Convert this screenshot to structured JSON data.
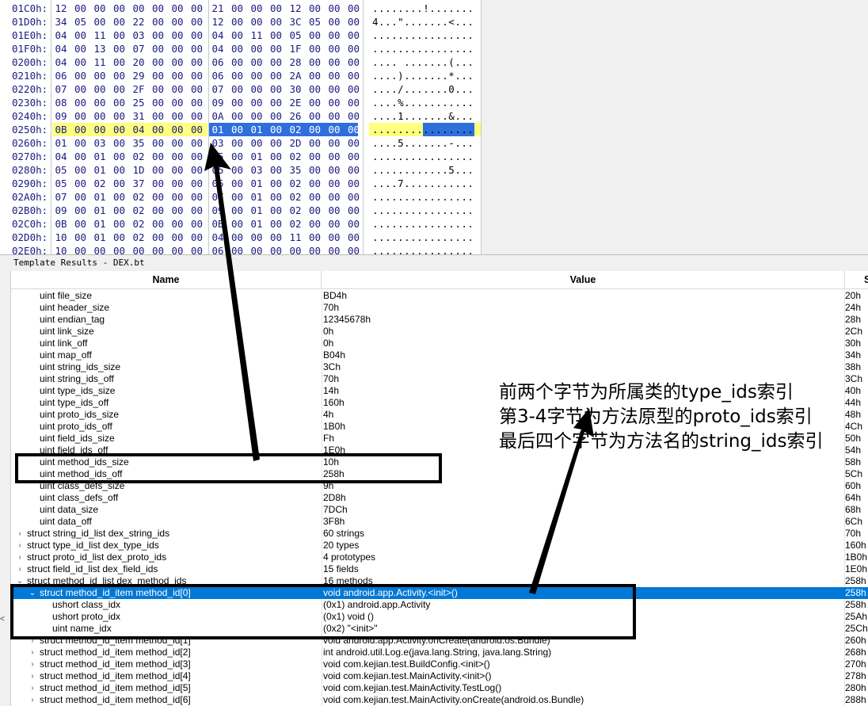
{
  "hex_view": {
    "rows": [
      {
        "addr": "01C0h:",
        "bytes": [
          "12",
          "00",
          "00",
          "00",
          "00",
          "00",
          "00",
          "00",
          "21",
          "00",
          "00",
          "00",
          "12",
          "00",
          "00",
          "00"
        ],
        "ascii": "........!......."
      },
      {
        "addr": "01D0h:",
        "bytes": [
          "34",
          "05",
          "00",
          "00",
          "22",
          "00",
          "00",
          "00",
          "12",
          "00",
          "00",
          "00",
          "3C",
          "05",
          "00",
          "00"
        ],
        "ascii": "4...\".......<..."
      },
      {
        "addr": "01E0h:",
        "bytes": [
          "04",
          "00",
          "11",
          "00",
          "03",
          "00",
          "00",
          "00",
          "04",
          "00",
          "11",
          "00",
          "05",
          "00",
          "00",
          "00"
        ],
        "ascii": "................"
      },
      {
        "addr": "01F0h:",
        "bytes": [
          "04",
          "00",
          "13",
          "00",
          "07",
          "00",
          "00",
          "00",
          "04",
          "00",
          "00",
          "00",
          "1F",
          "00",
          "00",
          "00"
        ],
        "ascii": "................"
      },
      {
        "addr": "0200h:",
        "bytes": [
          "04",
          "00",
          "11",
          "00",
          "20",
          "00",
          "00",
          "00",
          "06",
          "00",
          "00",
          "00",
          "28",
          "00",
          "00",
          "00"
        ],
        "ascii": ".... .......(..."
      },
      {
        "addr": "0210h:",
        "bytes": [
          "06",
          "00",
          "00",
          "00",
          "29",
          "00",
          "00",
          "00",
          "06",
          "00",
          "00",
          "00",
          "2A",
          "00",
          "00",
          "00"
        ],
        "ascii": "....).......*..."
      },
      {
        "addr": "0220h:",
        "bytes": [
          "07",
          "00",
          "00",
          "00",
          "2F",
          "00",
          "00",
          "00",
          "07",
          "00",
          "00",
          "00",
          "30",
          "00",
          "00",
          "00"
        ],
        "ascii": "..../.......0..."
      },
      {
        "addr": "0230h:",
        "bytes": [
          "08",
          "00",
          "00",
          "00",
          "25",
          "00",
          "00",
          "00",
          "09",
          "00",
          "00",
          "00",
          "2E",
          "00",
          "00",
          "00"
        ],
        "ascii": "....%..........."
      },
      {
        "addr": "0240h:",
        "bytes": [
          "09",
          "00",
          "00",
          "00",
          "31",
          "00",
          "00",
          "00",
          "0A",
          "00",
          "00",
          "00",
          "26",
          "00",
          "00",
          "00"
        ],
        "ascii": "....1.......&..."
      },
      {
        "addr": "0250h:",
        "bytes": [
          "0B",
          "00",
          "00",
          "00",
          "04",
          "00",
          "00",
          "00",
          "01",
          "00",
          "01",
          "00",
          "02",
          "00",
          "00",
          "00"
        ],
        "ascii": "................"
      },
      {
        "addr": "0260h:",
        "bytes": [
          "01",
          "00",
          "03",
          "00",
          "35",
          "00",
          "00",
          "00",
          "03",
          "00",
          "00",
          "00",
          "2D",
          "00",
          "00",
          "00"
        ],
        "ascii": "....5.......-..."
      },
      {
        "addr": "0270h:",
        "bytes": [
          "04",
          "00",
          "01",
          "00",
          "02",
          "00",
          "00",
          "00",
          "05",
          "00",
          "01",
          "00",
          "02",
          "00",
          "00",
          "00"
        ],
        "ascii": "................"
      },
      {
        "addr": "0280h:",
        "bytes": [
          "05",
          "00",
          "01",
          "00",
          "1D",
          "00",
          "00",
          "00",
          "05",
          "00",
          "03",
          "00",
          "35",
          "00",
          "00",
          "00"
        ],
        "ascii": "............5..."
      },
      {
        "addr": "0290h:",
        "bytes": [
          "05",
          "00",
          "02",
          "00",
          "37",
          "00",
          "00",
          "00",
          "05",
          "00",
          "01",
          "00",
          "02",
          "00",
          "00",
          "00"
        ],
        "ascii": "....7..........."
      },
      {
        "addr": "02A0h:",
        "bytes": [
          "07",
          "00",
          "01",
          "00",
          "02",
          "00",
          "00",
          "00",
          "07",
          "00",
          "01",
          "00",
          "02",
          "00",
          "00",
          "00"
        ],
        "ascii": "................"
      },
      {
        "addr": "02B0h:",
        "bytes": [
          "09",
          "00",
          "01",
          "00",
          "02",
          "00",
          "00",
          "00",
          "09",
          "00",
          "01",
          "00",
          "02",
          "00",
          "00",
          "00"
        ],
        "ascii": "................"
      },
      {
        "addr": "02C0h:",
        "bytes": [
          "0B",
          "00",
          "01",
          "00",
          "02",
          "00",
          "00",
          "00",
          "0B",
          "00",
          "01",
          "00",
          "02",
          "00",
          "00",
          "00"
        ],
        "ascii": "................"
      },
      {
        "addr": "02D0h:",
        "bytes": [
          "10",
          "00",
          "01",
          "00",
          "02",
          "00",
          "00",
          "00",
          "04",
          "00",
          "00",
          "00",
          "11",
          "00",
          "00",
          "00"
        ],
        "ascii": "................"
      },
      {
        "addr": "02E0h:",
        "bytes": [
          "10",
          "00",
          "00",
          "00",
          "00",
          "00",
          "00",
          "00",
          "06",
          "00",
          "00",
          "00",
          "00",
          "00",
          "00",
          "00"
        ],
        "ascii": "................"
      }
    ]
  },
  "template_results": {
    "title": "Template Results - DEX.bt",
    "columns": {
      "name": "Name",
      "value": "Value",
      "start": "S"
    },
    "rows": [
      {
        "name": "uint file_size",
        "value": "BD4h",
        "start": "20h",
        "indent": 2,
        "expander": ""
      },
      {
        "name": "uint header_size",
        "value": "70h",
        "start": "24h",
        "indent": 2,
        "expander": ""
      },
      {
        "name": "uint endian_tag",
        "value": "12345678h",
        "start": "28h",
        "indent": 2,
        "expander": ""
      },
      {
        "name": "uint link_size",
        "value": "0h",
        "start": "2Ch",
        "indent": 2,
        "expander": ""
      },
      {
        "name": "uint link_off",
        "value": "0h",
        "start": "30h",
        "indent": 2,
        "expander": ""
      },
      {
        "name": "uint map_off",
        "value": "B04h",
        "start": "34h",
        "indent": 2,
        "expander": ""
      },
      {
        "name": "uint string_ids_size",
        "value": "3Ch",
        "start": "38h",
        "indent": 2,
        "expander": ""
      },
      {
        "name": "uint string_ids_off",
        "value": "70h",
        "start": "3Ch",
        "indent": 2,
        "expander": ""
      },
      {
        "name": "uint type_ids_size",
        "value": "14h",
        "start": "40h",
        "indent": 2,
        "expander": ""
      },
      {
        "name": "uint type_ids_off",
        "value": "160h",
        "start": "44h",
        "indent": 2,
        "expander": ""
      },
      {
        "name": "uint proto_ids_size",
        "value": "4h",
        "start": "48h",
        "indent": 2,
        "expander": ""
      },
      {
        "name": "uint proto_ids_off",
        "value": "1B0h",
        "start": "4Ch",
        "indent": 2,
        "expander": ""
      },
      {
        "name": "uint field_ids_size",
        "value": "Fh",
        "start": "50h",
        "indent": 2,
        "expander": ""
      },
      {
        "name": "uint field_ids_off",
        "value": "1E0h",
        "start": "54h",
        "indent": 2,
        "expander": ""
      },
      {
        "name": "uint method_ids_size",
        "value": "10h",
        "start": "58h",
        "indent": 2,
        "expander": ""
      },
      {
        "name": "uint method_ids_off",
        "value": "258h",
        "start": "5Ch",
        "indent": 2,
        "expander": ""
      },
      {
        "name": "uint class_defs_size",
        "value": "9h",
        "start": "60h",
        "indent": 2,
        "expander": ""
      },
      {
        "name": "uint class_defs_off",
        "value": "2D8h",
        "start": "64h",
        "indent": 2,
        "expander": ""
      },
      {
        "name": "uint data_size",
        "value": "7DCh",
        "start": "68h",
        "indent": 2,
        "expander": ""
      },
      {
        "name": "uint data_off",
        "value": "3F8h",
        "start": "6Ch",
        "indent": 2,
        "expander": ""
      },
      {
        "name": "struct string_id_list dex_string_ids",
        "value": "60 strings",
        "start": "70h",
        "indent": 1,
        "expander": "›"
      },
      {
        "name": "struct type_id_list dex_type_ids",
        "value": "20 types",
        "start": "160h",
        "indent": 1,
        "expander": "›"
      },
      {
        "name": "struct proto_id_list dex_proto_ids",
        "value": "4 prototypes",
        "start": "1B0h",
        "indent": 1,
        "expander": "›"
      },
      {
        "name": "struct field_id_list dex_field_ids",
        "value": "15 fields",
        "start": "1E0h",
        "indent": 1,
        "expander": "›"
      },
      {
        "name": "struct method_id_list dex_method_ids",
        "value": "16 methods",
        "start": "258h",
        "indent": 1,
        "expander": "⌄"
      },
      {
        "name": "struct method_id_item method_id[0]",
        "value": "void android.app.Activity.<init>()",
        "start": "258h",
        "indent": 2,
        "expander": "⌄",
        "selected": true
      },
      {
        "name": "ushort class_idx",
        "value": "(0x1) android.app.Activity",
        "start": "258h",
        "indent": 3,
        "expander": ""
      },
      {
        "name": "ushort proto_idx",
        "value": "(0x1) void ()",
        "start": "25Ah",
        "indent": 3,
        "expander": ""
      },
      {
        "name": "uint name_idx",
        "value": "(0x2) \"<init>\"",
        "start": "25Ch",
        "indent": 3,
        "expander": ""
      },
      {
        "name": "struct method_id_item method_id[1]",
        "value": "void android.app.Activity.onCreate(android.os.Bundle)",
        "start": "260h",
        "indent": 2,
        "expander": "›"
      },
      {
        "name": "struct method_id_item method_id[2]",
        "value": "int android.util.Log.e(java.lang.String, java.lang.String)",
        "start": "268h",
        "indent": 2,
        "expander": "›"
      },
      {
        "name": "struct method_id_item method_id[3]",
        "value": "void com.kejian.test.BuildConfig.<init>()",
        "start": "270h",
        "indent": 2,
        "expander": "›"
      },
      {
        "name": "struct method_id_item method_id[4]",
        "value": "void com.kejian.test.MainActivity.<init>()",
        "start": "278h",
        "indent": 2,
        "expander": "›"
      },
      {
        "name": "struct method_id_item method_id[5]",
        "value": "void com.kejian.test.MainActivity.TestLog()",
        "start": "280h",
        "indent": 2,
        "expander": "›"
      },
      {
        "name": "struct method_id_item method_id[6]",
        "value": "void com.kejian.test.MainActivity.onCreate(android.os.Bundle)",
        "start": "288h",
        "indent": 2,
        "expander": "›"
      }
    ]
  },
  "annotation": {
    "lines": [
      "前两个字节为所属类的type_ids索引",
      "第3-4字节为方法原型的proto_ids索引",
      "最后四个字节为方法名的string_ids索引"
    ],
    "color": "#000000"
  },
  "colors": {
    "highlight_yellow": "#ffff80",
    "highlight_blue": "#2f6fdc",
    "selection": "#0078d7"
  }
}
